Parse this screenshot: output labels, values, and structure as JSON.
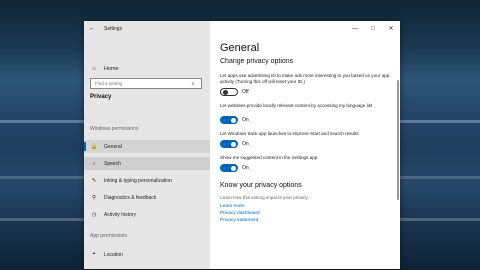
{
  "window": {
    "title": "Settings",
    "back_icon": "back-arrow-icon",
    "controls": {
      "minimize": "—",
      "maximize": "□",
      "close": "✕"
    }
  },
  "sidebar": {
    "home_label": "Home",
    "search_placeholder": "Find a setting",
    "breadcrumb": "Privacy",
    "windows_permissions_label": "Windows permissions",
    "items": [
      {
        "label": "General",
        "icon": "lock-icon"
      },
      {
        "label": "Speech",
        "icon": "microphone-icon"
      },
      {
        "label": "Inking & typing personalization",
        "icon": "pen-icon"
      },
      {
        "label": "Diagnostics & feedback",
        "icon": "diagnostics-icon"
      },
      {
        "label": "Activity history",
        "icon": "history-icon"
      }
    ],
    "app_permissions_label": "App permissions",
    "app_items": [
      {
        "label": "Location",
        "icon": "location-icon"
      }
    ]
  },
  "main": {
    "title": "General",
    "section_title": "Change privacy options",
    "options": [
      {
        "text": "Let apps use advertising ID to make ads more interesting to you based on your app activity (Turning this off will reset your ID.)",
        "state": "Off",
        "on": false
      },
      {
        "text": "Let websites provide locally relevant content by accessing my language list",
        "state": "On",
        "on": true
      },
      {
        "text": "Let Windows track app launches to improve Start and search results",
        "state": "On",
        "on": true
      },
      {
        "text": "Show me suggested content in the Settings app",
        "state": "On",
        "on": true
      }
    ],
    "know_title": "Know your privacy options",
    "know_desc": "Learn how this setting impacts your privacy.",
    "links": [
      "Learn more",
      "Privacy dashboard",
      "Privacy statement"
    ]
  },
  "colors": {
    "accent": "#0067c0",
    "sidebar_bg": "#e6e6e6"
  }
}
